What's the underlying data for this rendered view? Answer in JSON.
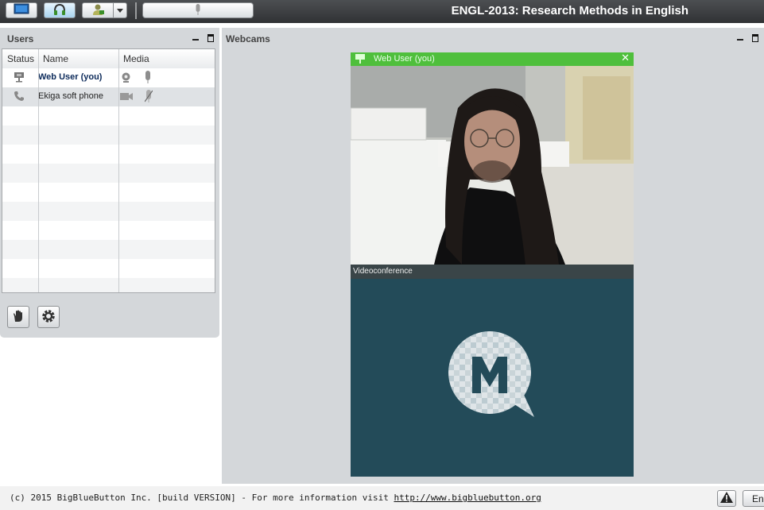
{
  "app": {
    "title": "ENGL-2013: Research Methods in English"
  },
  "users_panel": {
    "title": "Users",
    "columns": [
      "Status",
      "Name",
      "Media"
    ],
    "rows": [
      {
        "name": "Web User (you)",
        "status_icon": "presenter-icon",
        "media": [
          "webcam-icon",
          "microphone-icon"
        ]
      },
      {
        "name": "Ekiga soft phone",
        "status_icon": "phone-icon",
        "media": [
          "video-camera-icon",
          "microphone-muted-icon"
        ]
      }
    ]
  },
  "webcams_panel": {
    "title": "Webcams",
    "video_label": "Web User (you)",
    "close_symbol": "✕",
    "conference_label": "Videoconference"
  },
  "footer": {
    "text": "(c) 2015 BigBlueButton Inc. [build VERSION] - For more information visit ",
    "link": "http://www.bigbluebutton.org",
    "lang_label": "En"
  },
  "colors": {
    "topbar": "#3c3f42",
    "panel_bg": "#d4d7da",
    "video_title_green": "#4fbf3c",
    "conference_bg": "#234b59"
  }
}
